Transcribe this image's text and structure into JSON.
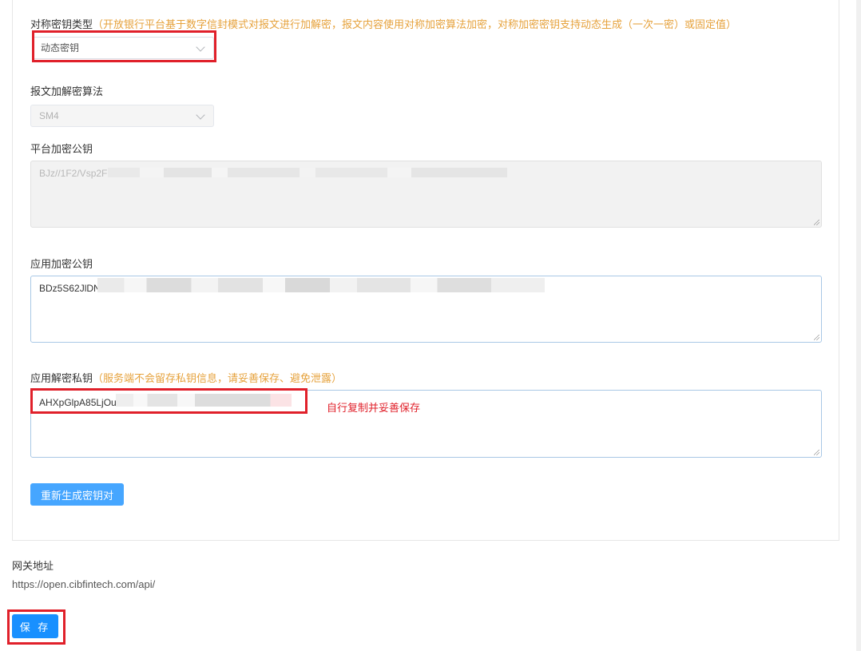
{
  "form": {
    "sym_key_type": {
      "label": "对称密钥类型",
      "hint": "（开放银行平台基于数字信封模式对报文进行加解密，报文内容使用对称加密算法加密，对称加密密钥支持动态生成（一次一密）或固定值）",
      "value": "动态密钥"
    },
    "encrypt_algorithm": {
      "label": "报文加解密算法",
      "value": "SM4"
    },
    "platform_public_key": {
      "label": "平台加密公钥",
      "value_visible": "BJz//1F2/Vsp2F"
    },
    "app_public_key": {
      "label": "应用加密公钥",
      "value_visible": "BDz5S62JlDN"
    },
    "app_private_key": {
      "label": "应用解密私钥",
      "hint": "（服务端不会留存私钥信息，请妥善保存、避免泄露）",
      "value_visible": "AHXpGlpA85LjOu",
      "annotation": "自行复制并妥善保存"
    },
    "regenerate_button": "重新生成密钥对"
  },
  "gateway": {
    "label": "网关地址",
    "url": "https://open.cibfintech.com/api/"
  },
  "save_button": "保 存",
  "colors": {
    "hint": "#e6a23c",
    "primary": "#1890ff",
    "regen_button": "#46a6ff",
    "highlight_box": "#e0202a"
  }
}
